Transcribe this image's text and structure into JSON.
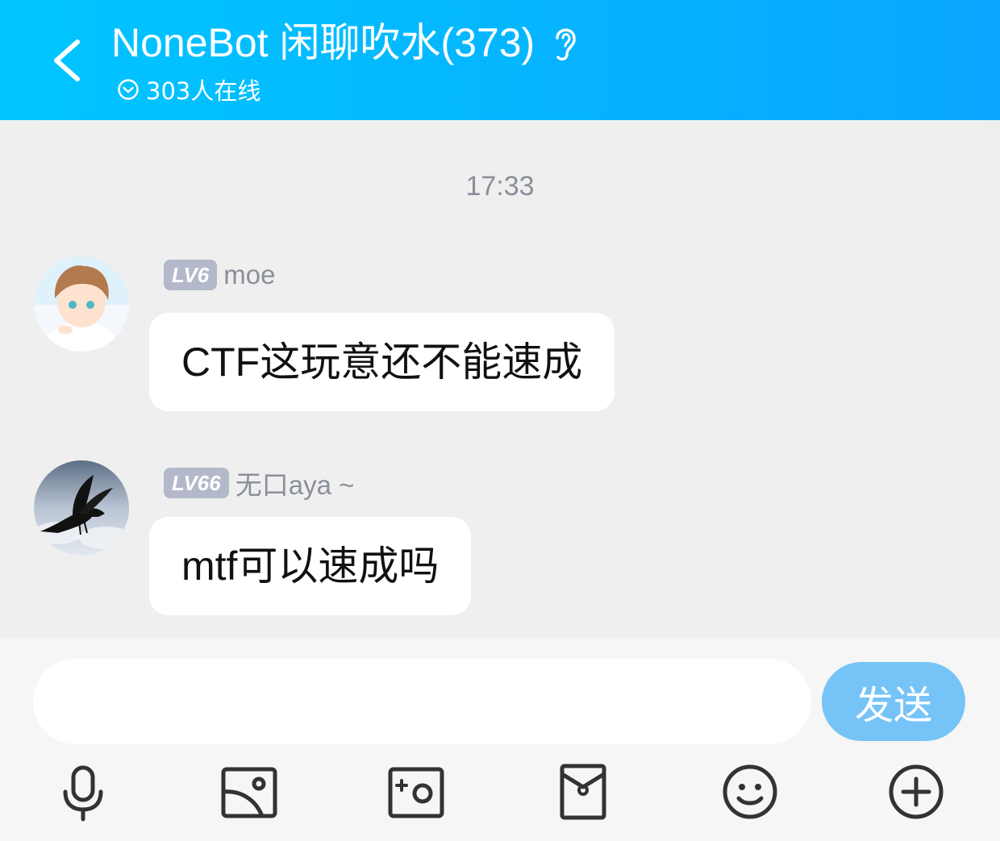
{
  "header": {
    "title": "NoneBot 闲聊吹水(373)",
    "online": "303人在线",
    "colors": {
      "gradient_start": "#00c6ff",
      "gradient_end": "#0aa6ff"
    }
  },
  "chat": {
    "timestamp": "17:33",
    "messages": [
      {
        "level": "LV6",
        "sender": "moe",
        "text": "CTF这玩意还不能速成"
      },
      {
        "level": "LV66",
        "sender": "无口aya ~",
        "text": "mtf可以速成吗"
      }
    ]
  },
  "composer": {
    "placeholder": "",
    "send_label": "发送"
  },
  "toolbar": {
    "icons": [
      "microphone-icon",
      "image-icon",
      "camera-icon",
      "red-packet-icon",
      "emoji-icon",
      "plus-icon"
    ]
  }
}
